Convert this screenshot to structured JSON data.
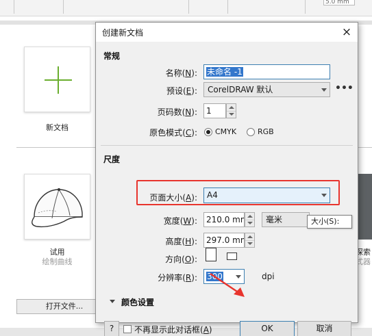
{
  "background": {
    "top_field_value": "5.0 mm",
    "new_doc_label": "新文档",
    "trial_title": "试用",
    "trial_subtitle": "绘制曲线",
    "open_file_button": "打开文件...",
    "right_card_label_1": "探索",
    "right_card_label_2": "式器"
  },
  "dialog": {
    "title": "创建新文档",
    "close_icon": "×",
    "general_section": "常规",
    "name_label": "名称",
    "name_key": "N",
    "name_value": "未命名 -1",
    "preset_label": "预设",
    "preset_key": "E",
    "preset_value": "CorelDRAW 默认",
    "more_icon": "•••",
    "pages_label": "页码数",
    "pages_key": "N",
    "pages_value": "1",
    "color_mode_label": "原色模式",
    "color_mode_key": "C",
    "color_mode_options": [
      "CMYK",
      "RGB"
    ],
    "color_mode_selected": "CMYK",
    "dimensions_section": "尺度",
    "page_size_label": "页面大小",
    "page_size_key": "A",
    "page_size_value": "A4",
    "width_label": "宽度",
    "width_key": "W",
    "width_value": "210.0 mm",
    "unit_value": "毫米",
    "height_label": "高度",
    "height_key": "H",
    "height_value": "297.0 mm",
    "orientation_label": "方向",
    "orientation_key": "O",
    "resolution_label": "分辨率",
    "resolution_key": "R",
    "resolution_value": "300",
    "resolution_unit": "dpi",
    "tooltip": "大小(S):",
    "color_settings": "颜色设置",
    "help_button": "?",
    "dont_show_label": "不再显示此对话框",
    "dont_show_key": "A",
    "ok_button": "OK",
    "cancel_button": "取消"
  },
  "colors": {
    "highlight_box": "#e8342d",
    "plus_green": "#6aae2e",
    "selection_blue": "#3377cc"
  }
}
